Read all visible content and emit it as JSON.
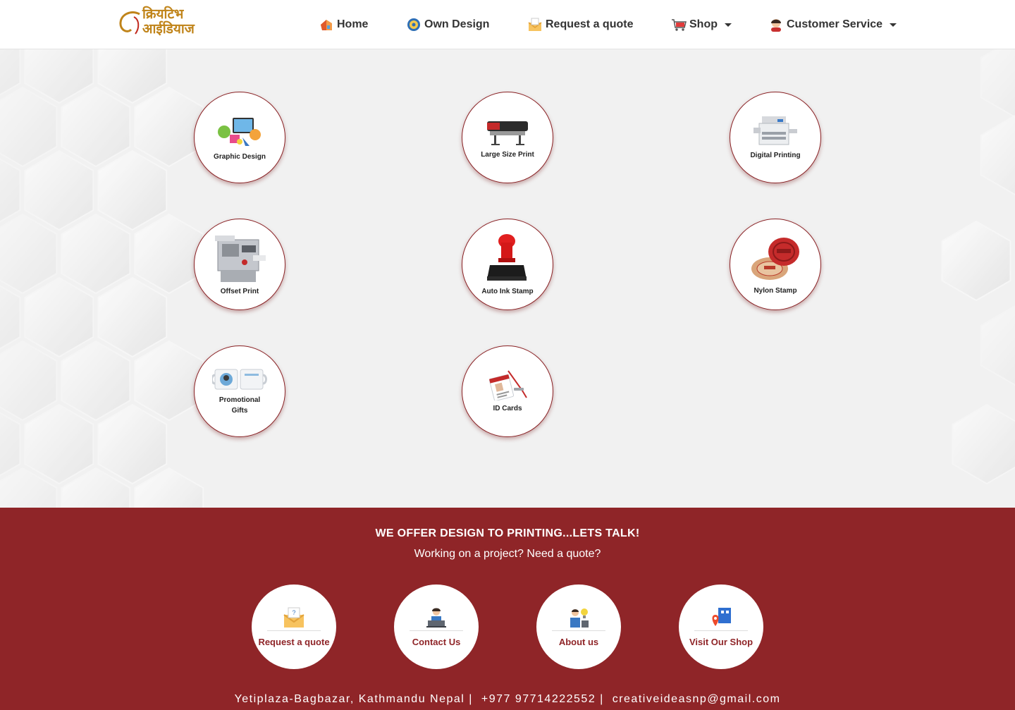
{
  "brand": {
    "logo_text_line1": "क्रियटिभ",
    "logo_text_line2": "आईडियाज",
    "color": "#c0841a"
  },
  "nav": {
    "items": [
      {
        "label": "Home",
        "icon": "house-icon"
      },
      {
        "label": "Own Design",
        "icon": "gear-icon"
      },
      {
        "label": "Request a quote",
        "icon": "envelope-icon"
      },
      {
        "label": "Shop",
        "icon": "cart-icon",
        "dropdown": true
      },
      {
        "label": "Customer Service",
        "icon": "agent-icon",
        "dropdown": true
      }
    ]
  },
  "services": [
    {
      "label": "Graphic Design",
      "icon": "graphic-design-icon"
    },
    {
      "label": "Large Size Print",
      "icon": "large-printer-icon"
    },
    {
      "label": "Digital Printing",
      "icon": "digital-printer-icon"
    },
    {
      "label": "Offset Print",
      "icon": "offset-press-icon"
    },
    {
      "label": "Auto Ink Stamp",
      "icon": "ink-stamp-icon"
    },
    {
      "label": "Nylon Stamp",
      "icon": "nylon-stamp-icon"
    },
    {
      "label": "Promotional Gifts",
      "icon": "mug-icon"
    },
    {
      "label": "ID Cards",
      "icon": "id-card-icon"
    }
  ],
  "footer": {
    "title": "WE OFFER DESIGN TO PRINTING...LETS TALK!",
    "subtitle": "Working on a project? Need a quote?",
    "actions": [
      {
        "label": "Request a quote",
        "icon": "envelope-icon"
      },
      {
        "label": "Contact Us",
        "icon": "support-person-icon"
      },
      {
        "label": "About us",
        "icon": "team-icon"
      },
      {
        "label": "Visit Our Shop",
        "icon": "map-pin-icon"
      }
    ],
    "address": "Yetiplaza-Bagbazar, Kathmandu Nepal |",
    "phone": "+977 97714222552 |",
    "email": "creativeideasnp@gmail.com"
  },
  "colors": {
    "accent": "#8f2528",
    "nav_text": "#333333",
    "background": "#f1f1f1"
  }
}
